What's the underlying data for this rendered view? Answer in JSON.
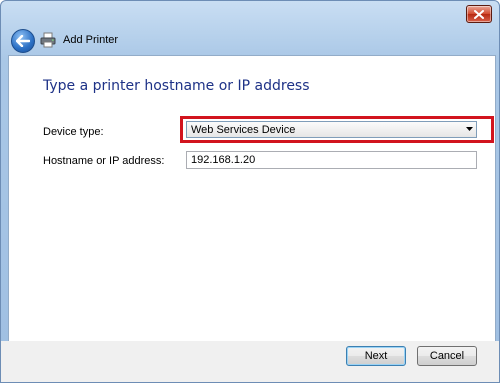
{
  "header": {
    "title": "Add Printer",
    "back_icon": "back-arrow-icon",
    "app_icon": "printer-icon"
  },
  "window": {
    "close_icon": "close-icon"
  },
  "main": {
    "heading": "Type a printer hostname or IP address",
    "device_type": {
      "label": "Device type:",
      "selected": "Web Services Device",
      "highlight_color": "#d2141e"
    },
    "hostname": {
      "label": "Hostname or IP address:",
      "value": "192.168.1.20"
    }
  },
  "footer": {
    "next_label": "Next",
    "cancel_label": "Cancel"
  }
}
